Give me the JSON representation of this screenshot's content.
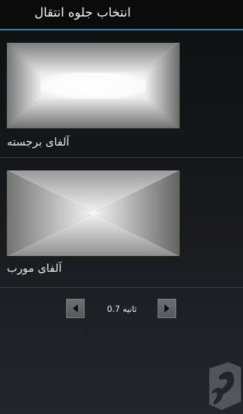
{
  "header": {
    "title": "انتخاب جلوه انتقال"
  },
  "transitions": [
    {
      "label": "آلفای برجسته",
      "preview": "radial-bright-alpha"
    },
    {
      "label": "آلفای مورب",
      "preview": "diagonal-alpha"
    }
  ],
  "duration": {
    "value": "0.7",
    "unit": "ثانیه",
    "text": "0.7 ثانیه"
  },
  "icons": {
    "previous": "triangle-left-icon",
    "next": "triangle-right-icon",
    "watermark": "bazaar-logo-icon"
  },
  "colors": {
    "accent": "#2c8fc0",
    "actionbar": "#0b0b0c",
    "background": "#141619",
    "divider": "#3a3f46",
    "button": "#636568"
  }
}
